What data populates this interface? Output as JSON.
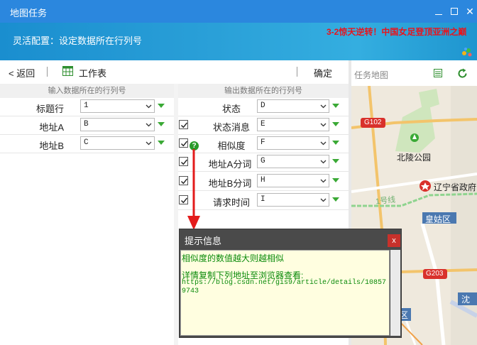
{
  "window": {
    "title": "地图任务"
  },
  "banner": {
    "subtitle": "灵活配置：设定数据所在行列号",
    "news": "3-2惊天逆转！中国女足登顶亚洲之巅"
  },
  "toolbar": {
    "back_label": "< 返回",
    "sheet_label": "工作表",
    "confirm_label": "确定"
  },
  "input_section": {
    "header": "输入数据所在的行列号",
    "rows": [
      {
        "label": "标题行",
        "value": "1"
      },
      {
        "label": "地址A",
        "value": "B"
      },
      {
        "label": "地址B",
        "value": "C"
      }
    ]
  },
  "output_section": {
    "header": "输出数据所在的行列号",
    "rows": [
      {
        "label": "状态",
        "value": "D",
        "checkbox": false
      },
      {
        "label": "状态消息",
        "value": "E",
        "checkbox": true
      },
      {
        "label": "相似度",
        "value": "F",
        "checkbox": true
      },
      {
        "label": "地址A分词",
        "value": "G",
        "checkbox": true
      },
      {
        "label": "地址B分词",
        "value": "H",
        "checkbox": true
      },
      {
        "label": "请求时间",
        "value": "I",
        "checkbox": true
      }
    ]
  },
  "map": {
    "title": "任务地图",
    "labels": {
      "road_g102": "G102",
      "park": "北陵公园",
      "gov": "辽宁省政府",
      "metro": "1号线",
      "district": "皇姑区",
      "road_g203": "G203",
      "district2": "区",
      "district3": "沈"
    }
  },
  "dialog": {
    "title": "提示信息",
    "close_label": "x",
    "line1": "相似度的数值越大则越相似",
    "line2": "详情复制下列地址至浏览器查看:",
    "url": "https://blog.csdn.net/gis9/article/details/108579743"
  },
  "colors": {
    "accent_green": "#3aa935",
    "title_bar": "#2b87de",
    "alert_red": "#e8141c"
  }
}
